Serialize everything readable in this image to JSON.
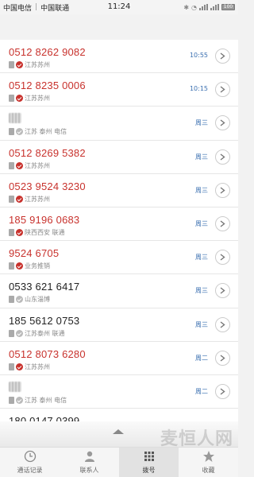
{
  "status_bar": {
    "carrier1": "中国电信",
    "carrier2": "中国联通",
    "time": "11:24",
    "battery": "100"
  },
  "calls": [
    {
      "number": "0512 8262 9082",
      "location": "江苏苏州",
      "time": "10:55",
      "color": "red",
      "type": "in"
    },
    {
      "number": "0512 8235 0006",
      "location": "江苏苏州",
      "time": "10:15",
      "color": "red",
      "type": "in"
    },
    {
      "number": "",
      "location": "江苏 泰州 电信",
      "time": "周三",
      "color": "black",
      "type": "gray",
      "blurred": true
    },
    {
      "number": "0512 8269 5382",
      "location": "江苏苏州",
      "time": "周三",
      "color": "red",
      "type": "in"
    },
    {
      "number": "0523 9524 3230",
      "location": "江苏苏州",
      "time": "周三",
      "color": "red",
      "type": "in"
    },
    {
      "number": "185 9196 0683",
      "location": "陕西西安 联通",
      "time": "周三",
      "color": "red",
      "type": "in"
    },
    {
      "number": "9524 6705",
      "location": "业务推销",
      "time": "周三",
      "color": "red",
      "type": "in"
    },
    {
      "number": "0533 621 6417",
      "location": "山东淄博",
      "time": "周三",
      "color": "black",
      "type": "gray"
    },
    {
      "number": "185 5612 0753",
      "location": "江苏泰州 联通",
      "time": "周三",
      "color": "black",
      "type": "gray"
    },
    {
      "number": "0512 8073 6280",
      "location": "江苏苏州",
      "time": "周二",
      "color": "red",
      "type": "in"
    },
    {
      "number": "",
      "location": "江苏 泰州 电信",
      "time": "周二",
      "color": "black",
      "type": "gray",
      "blurred": true
    },
    {
      "number": "180 0147 0399",
      "location": "",
      "time": "",
      "color": "black",
      "type": "gray"
    }
  ],
  "watermark": "麦恒人网",
  "tabs": [
    {
      "label": "通话记录",
      "icon": "clock-icon"
    },
    {
      "label": "联系人",
      "icon": "person-icon"
    },
    {
      "label": "拨号",
      "icon": "dialpad-icon",
      "active": true
    },
    {
      "label": "收藏",
      "icon": "star-icon"
    }
  ]
}
